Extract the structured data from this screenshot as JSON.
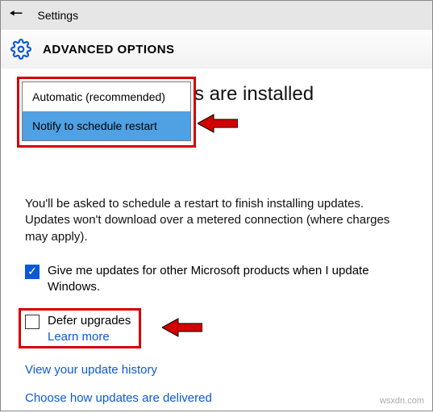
{
  "titlebar": {
    "title": "Settings"
  },
  "subheader": {
    "title": "ADVANCED OPTIONS"
  },
  "heading_partial_visible": "s are installed",
  "dropdown": {
    "options": [
      {
        "label": "Automatic (recommended)",
        "selected": false
      },
      {
        "label": "Notify to schedule restart",
        "selected": true
      }
    ]
  },
  "description": "You'll be asked to schedule a restart to finish installing updates. Updates won't download over a metered connection (where charges may apply).",
  "checkbox_products": {
    "checked": true,
    "label": "Give me updates for other Microsoft products when I update Windows."
  },
  "defer": {
    "checked": false,
    "label": "Defer upgrades",
    "learn_more": "Learn more"
  },
  "links": {
    "history": "View your update history",
    "delivery": "Choose how updates are delivered"
  },
  "attribution": "wsxdn.com"
}
